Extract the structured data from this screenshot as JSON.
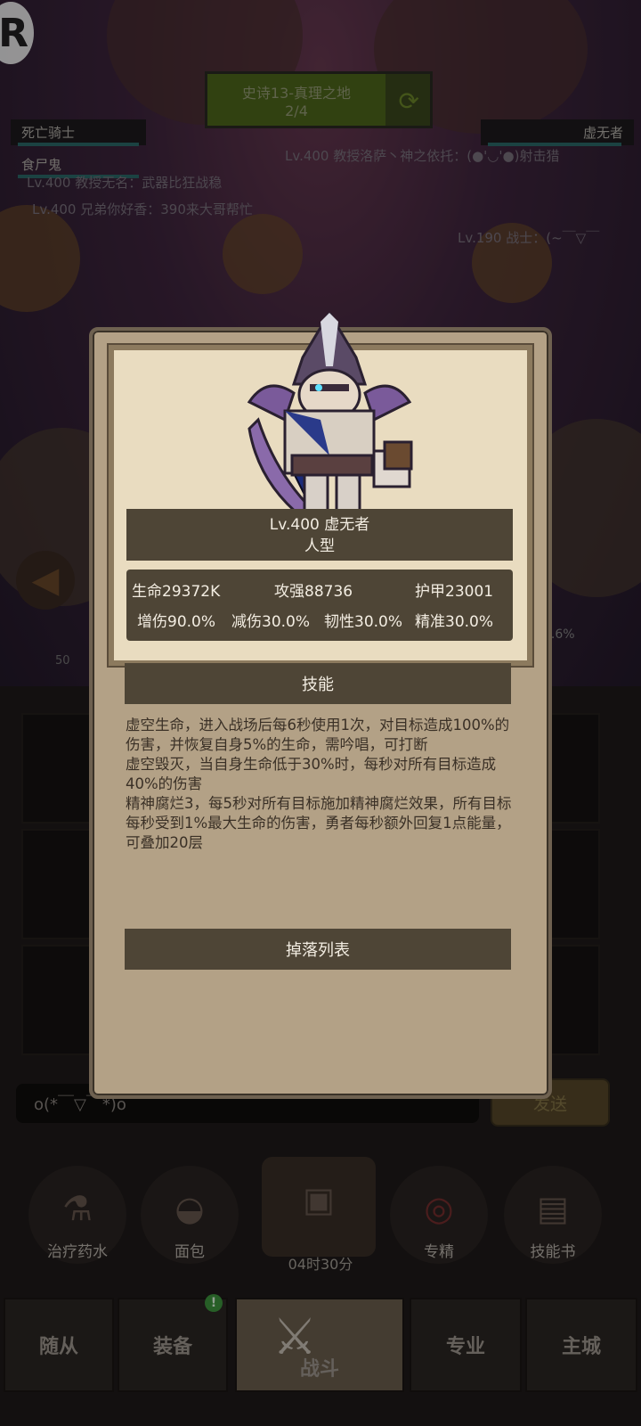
{
  "background": {
    "app_logo": "R",
    "stage": {
      "title": "史诗13-真理之地",
      "wave": "2/4",
      "refresh_icon": "refresh-icon"
    },
    "team_left": [
      "死亡骑士",
      "食尸鬼"
    ],
    "team_right": [
      "虚无者"
    ],
    "chat_lines": [
      "Lv.400 教授洛萨丶神之依托：(●'◡'●)射击猎",
      "Lv.400 教授无名：武器比狂战稳",
      "Lv.400 兄弟你好香：390来大哥帮忙",
      "Lv.190 战士：(~￣▽￣"
    ],
    "progress_pct": "2.6%",
    "level_tag": "50"
  },
  "chat": {
    "input_value": "o(*￣▽￣*)o",
    "send_label": "发送"
  },
  "items": [
    {
      "label": "治疗药水",
      "icon": "potion-icon"
    },
    {
      "label": "面包",
      "icon": "bread-icon"
    },
    {
      "label": "专精",
      "icon": "target-icon"
    },
    {
      "label": "技能书",
      "icon": "book-icon"
    }
  ],
  "chest_timer": "04时30分",
  "nav": {
    "followers": "随从",
    "equipment": "装备",
    "equipment_badge": "!",
    "battle": "战斗",
    "profession": "专业",
    "main_city": "主城"
  },
  "modal": {
    "name_line": "Lv.400 虚无者",
    "type_line": "人型",
    "stats": {
      "hp": "生命29372K",
      "attack": "攻强88736",
      "armor": "护甲23001",
      "damage_up": "增伤90.0%",
      "damage_down": "减伤30.0%",
      "tenacity": "韧性30.0%",
      "precision": "精准30.0%"
    },
    "skills_header": "技能",
    "skills": [
      "虚空生命，进入战场后每6秒使用1次，对目标造成100%的伤害，并恢复自身5%的生命，需吟唱，可打断",
      "虚空毁灭，当自身生命低于30%时，每秒对所有目标造成40%的伤害",
      "精神腐烂3，每5秒对所有目标施加精神腐烂效果，所有目标每秒受到1%最大生命的伤害，勇者每秒额外回复1点能量，可叠加20层"
    ],
    "drop_list": "掉落列表"
  }
}
